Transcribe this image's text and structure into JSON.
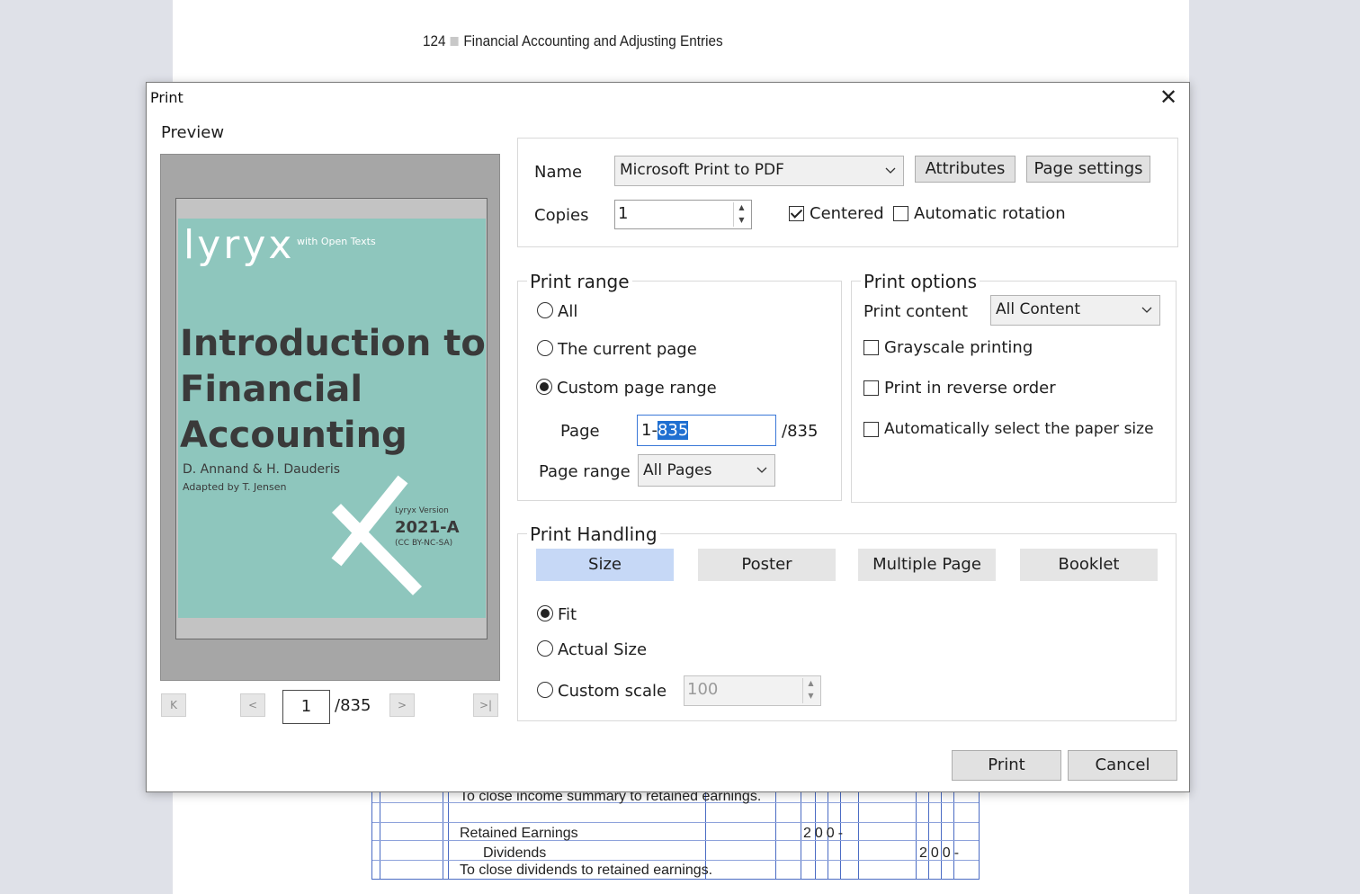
{
  "background_doc": {
    "page_number": "124",
    "chapter_title": "Financial Accounting and Adjusting Entries",
    "rows": [
      {
        "description": "To close income summary to retained earnings.",
        "debit": "",
        "credit": ""
      },
      {
        "description": "Retained Earnings",
        "debit": "200-",
        "credit": ""
      },
      {
        "description": "Dividends",
        "debit": "",
        "credit": "200-"
      },
      {
        "description": "To close dividends to retained earnings.",
        "debit": "",
        "credit": ""
      }
    ]
  },
  "dialog": {
    "title": "Print",
    "close_icon": "close-icon",
    "preview": {
      "label": "Preview",
      "cover": {
        "logo": "lyryx",
        "logo_sub": "with Open Texts",
        "title_lines": [
          "Introduction to",
          "Financial",
          "Accounting"
        ],
        "authors": "D. Annand & H. Dauderis",
        "adapted": "Adapted by T. Jensen",
        "version_label": "Lyryx Version",
        "version": "2021-A",
        "license": "(CC BY-NC-SA)",
        "color": "#8ec6bd"
      },
      "nav": {
        "first_icon": "first-page-icon",
        "prev_icon": "prev-page-icon",
        "next_icon": "next-page-icon",
        "last_icon": "last-page-icon",
        "current_page": "1",
        "total": "/835"
      }
    },
    "printer": {
      "name_label": "Name",
      "name_value": "Microsoft Print to PDF",
      "attributes_label": "Attributes",
      "page_settings_label": "Page settings",
      "copies_label": "Copies",
      "copies_value": "1",
      "centered_label": "Centered",
      "centered_checked": true,
      "auto_rotation_label": "Automatic rotation",
      "auto_rotation_checked": false
    },
    "print_range": {
      "legend": "Print range",
      "options": [
        "All",
        "The current page",
        "Custom page range"
      ],
      "selected": "Custom page range",
      "page_label": "Page",
      "page_value_prefix": "1-",
      "page_value_selected": "835",
      "page_total": "/835",
      "page_range_label": "Page range",
      "page_range_value": "All Pages"
    },
    "print_options": {
      "legend": "Print options",
      "content_label": "Print content",
      "content_value": "All Content",
      "grayscale_label": "Grayscale printing",
      "reverse_label": "Print in reverse order",
      "auto_paper_label": "Automatically select the paper size"
    },
    "print_handling": {
      "legend": "Print Handling",
      "tabs": [
        "Size",
        "Poster",
        "Multiple Page",
        "Booklet"
      ],
      "active_tab": "Size",
      "fit_label": "Fit",
      "actual_size_label": "Actual Size",
      "custom_scale_label": "Custom scale",
      "custom_scale_value": "100",
      "selected": "Fit",
      "accent": "#c6d8f6"
    },
    "buttons": {
      "print": "Print",
      "cancel": "Cancel"
    }
  }
}
